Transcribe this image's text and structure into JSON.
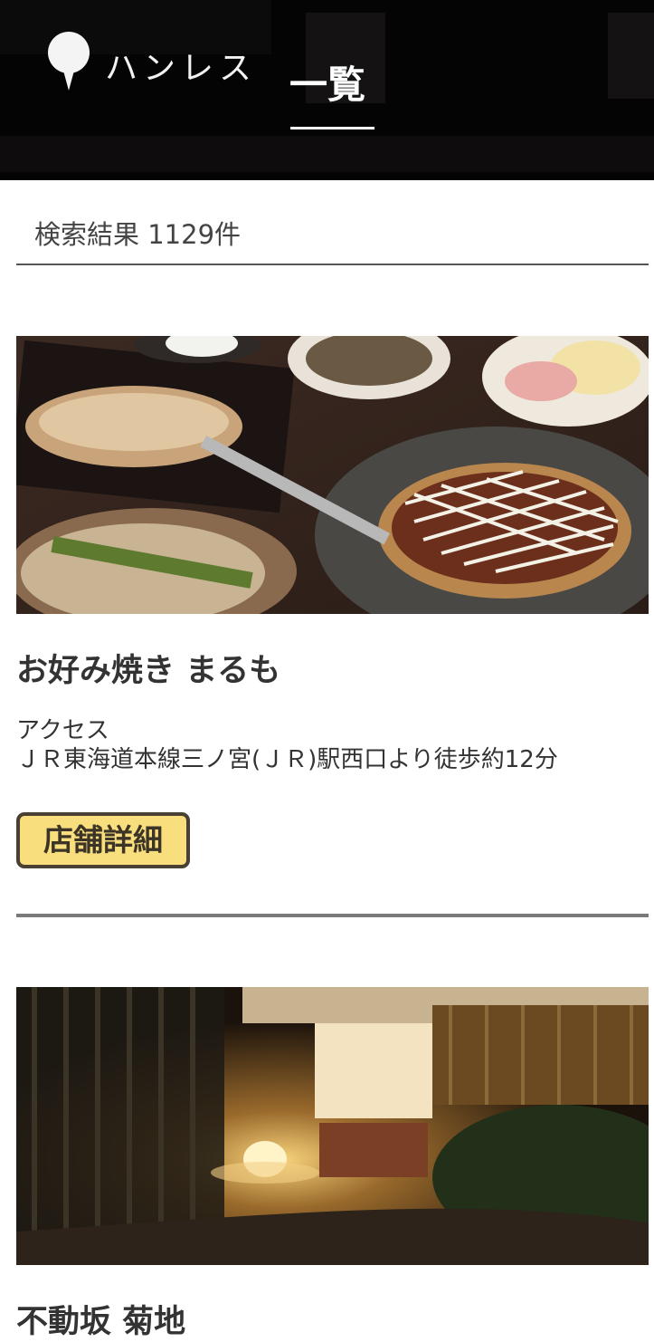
{
  "header": {
    "logo_text": "ハンレス",
    "page_title": "一覧"
  },
  "results": {
    "count_label": "検索結果 1129件"
  },
  "shops": [
    {
      "name": "お好み焼き まるも",
      "access_label": "アクセス",
      "access_value": "ＪＲ東海道本線三ノ宮(ＪＲ)駅西口より徒歩約12分",
      "detail_button": "店舗詳細"
    },
    {
      "name": "不動坂 菊地"
    }
  ],
  "colors": {
    "header_bg": "#050404",
    "button_bg": "#f8de7c",
    "button_border": "#4a3f33",
    "divider": "#7a7a7a"
  }
}
